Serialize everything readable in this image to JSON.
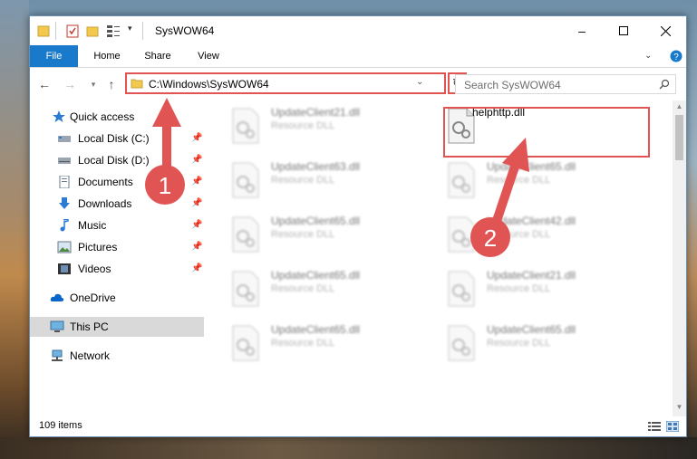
{
  "window": {
    "title": "SysWOW64"
  },
  "ribbon": {
    "tabs": [
      {
        "label": "File"
      },
      {
        "label": "Home"
      },
      {
        "label": "Share"
      },
      {
        "label": "View"
      }
    ]
  },
  "address": {
    "path": "C:\\Windows\\SysWOW64"
  },
  "search": {
    "placeholder": "Search SysWOW64"
  },
  "nav": {
    "items": [
      {
        "label": "Quick access",
        "icon": "star-icon"
      },
      {
        "label": "Local Disk (C:)",
        "icon": "drive-icon"
      },
      {
        "label": "Local Disk (D:)",
        "icon": "drive-icon"
      },
      {
        "label": "Documents",
        "icon": "documents-icon"
      },
      {
        "label": "Downloads",
        "icon": "download-icon"
      },
      {
        "label": "Music",
        "icon": "music-icon"
      },
      {
        "label": "Pictures",
        "icon": "pictures-icon"
      },
      {
        "label": "Videos",
        "icon": "videos-icon"
      },
      {
        "label": "OneDrive",
        "icon": "cloud-icon"
      },
      {
        "label": "This PC",
        "icon": "computer-icon"
      },
      {
        "label": "Network",
        "icon": "network-icon"
      }
    ]
  },
  "files": [
    {
      "name": "UpdateClient21.dll",
      "type": "Resource DLL"
    },
    {
      "name": "helphttp.dll",
      "type": ""
    },
    {
      "name": "UpdateClient63.dll",
      "type": "Resource DLL"
    },
    {
      "name": "UpdateClient65.dll",
      "type": "Resource DLL"
    },
    {
      "name": "UpdateClient65.dll",
      "type": "Resource DLL"
    },
    {
      "name": "UpdateClient42.dll",
      "type": "Resource DLL"
    },
    {
      "name": "UpdateClient65.dll",
      "type": "Resource DLL"
    },
    {
      "name": "UpdateClient21.dll",
      "type": "Resource DLL"
    },
    {
      "name": "UpdateClient65.dll",
      "type": "Resource DLL"
    },
    {
      "name": "UpdateClient65.dll",
      "type": "Resource DLL"
    }
  ],
  "status": {
    "count": "109 items"
  },
  "annotations": {
    "step1": "1",
    "step2": "2"
  },
  "colors": {
    "accent": "#1979ca",
    "highlight": "#e05454",
    "selected": "#d9d9d9"
  }
}
